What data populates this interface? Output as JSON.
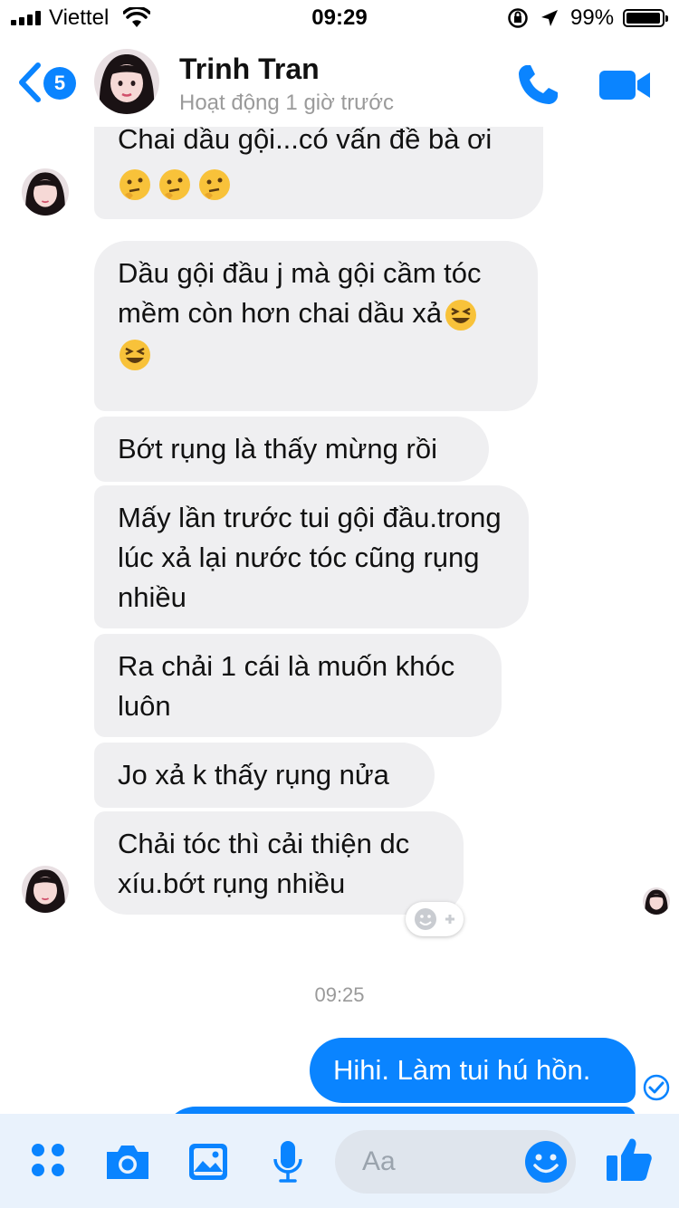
{
  "status_bar": {
    "carrier": "Viettel",
    "time": "09:29",
    "battery": "99%"
  },
  "header": {
    "back_badge": "5",
    "name": "Trinh Tran",
    "subtitle": "Hoạt động 1 giờ trước"
  },
  "messages": [
    {
      "text": "Chai dầu gội...có vấn đề bà ơi",
      "emoji": [
        "thinking-face",
        "thinking-face",
        "thinking-face"
      ]
    },
    {
      "text": "Dầu gội đầu j mà gội cầm tóc mềm còn hơn chai dầu xả",
      "emoji": [
        "grinning-squint-face",
        "grinning-squint-face"
      ]
    },
    {
      "text": "Bớt rụng là thấy mừng rồi"
    },
    {
      "text": "Mấy lần trước tui gội đầu.trong lúc xả lại nước tóc cũng rụng nhiều"
    },
    {
      "text": "Ra chải 1 cái là muốn khóc luôn"
    },
    {
      "text": "Jo xả k thấy rụng nửa"
    },
    {
      "text": "Chải tóc thì cải thiện dc xíu.bớt rụng nhiều"
    }
  ],
  "timestamp": "09:25",
  "outgoing": [
    {
      "text": "Hihi. Làm tui hú hồn."
    }
  ],
  "composer": {
    "placeholder": "Aa"
  },
  "colors": {
    "accent": "#0a84ff",
    "incoming_bubble": "#efeff1",
    "composer_bg": "#e9f2fc"
  },
  "icons": [
    "menu-dots-icon",
    "camera-icon",
    "gallery-icon",
    "microphone-icon",
    "emoji-icon",
    "like-icon",
    "phone-icon",
    "video-icon",
    "back-chevron-icon",
    "add-reaction-icon",
    "seen-check-icon"
  ]
}
